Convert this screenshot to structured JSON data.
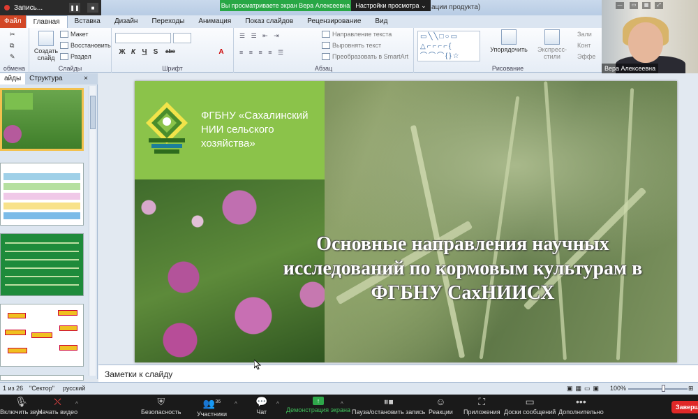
{
  "recording": {
    "label": "Запись...",
    "pause_icon": "pause-icon",
    "stop_icon": "stop-icon"
  },
  "share_banner": {
    "viewing_text": "Вы просматриваете экран Вера Алексеевна",
    "view_options": "Настройки просмотра"
  },
  "window_title": "ации продукта)",
  "ribbon_tabs": [
    "Файл",
    "Главная",
    "Вставка",
    "Дизайн",
    "Переходы",
    "Анимация",
    "Показ слайдов",
    "Рецензирование",
    "Вид"
  ],
  "ribbon": {
    "clipboard_group": "обмена",
    "slides_group": "Слайды",
    "new_slide": "Создать слайд",
    "layout": "Макет",
    "reset": "Восстановить",
    "section": "Раздел",
    "font_group": "Шрифт",
    "paragraph_group": "Абзац",
    "text_direction": "Направление текста",
    "align_text": "Выровнять текст",
    "convert_smartart": "Преобразовать в SmartArt",
    "drawing_group": "Рисование",
    "arrange": "Упорядочить",
    "quick_styles": "Экспресс-стили",
    "fill_short": "Зали",
    "outline_short": "Конт",
    "effects_short": "Эффе",
    "bold": "Ж",
    "italic": "К",
    "underline": "Ч",
    "shadow": "S",
    "strike": "abc",
    "font_color": "A"
  },
  "video": {
    "participant_name": "Вера Алексеевна"
  },
  "left_pane": {
    "tab_slides": "айды",
    "tab_outline": "Структура"
  },
  "slide": {
    "org_name": "ФГБНУ «Сахалинский НИИ сельского хозяйства»",
    "title": "Основные направления научных исследований по кормовым культурам в ФГБНУ СахНИИСХ"
  },
  "notes_placeholder": "Заметки к слайду",
  "status": {
    "slide_counter": "1 из 26",
    "theme": "\"Сектор\"",
    "language": "русский",
    "zoom": "100%"
  },
  "zoom_toolbar": {
    "audio": "Включить звук",
    "video": "Начать видео",
    "security": "Безопасность",
    "participants": "Участники",
    "participants_count": "36",
    "chat": "Чат",
    "share": "Демонстрация экрана",
    "record": "Пауза/остановить запись",
    "reactions": "Реакции",
    "apps": "Приложения",
    "whiteboards": "Доски сообщений",
    "more": "Дополнительно",
    "end": "Заверш"
  },
  "colors": {
    "accent_green": "#8bc34a",
    "zoom_end": "#e02828",
    "ribbon_file": "#d24726"
  }
}
